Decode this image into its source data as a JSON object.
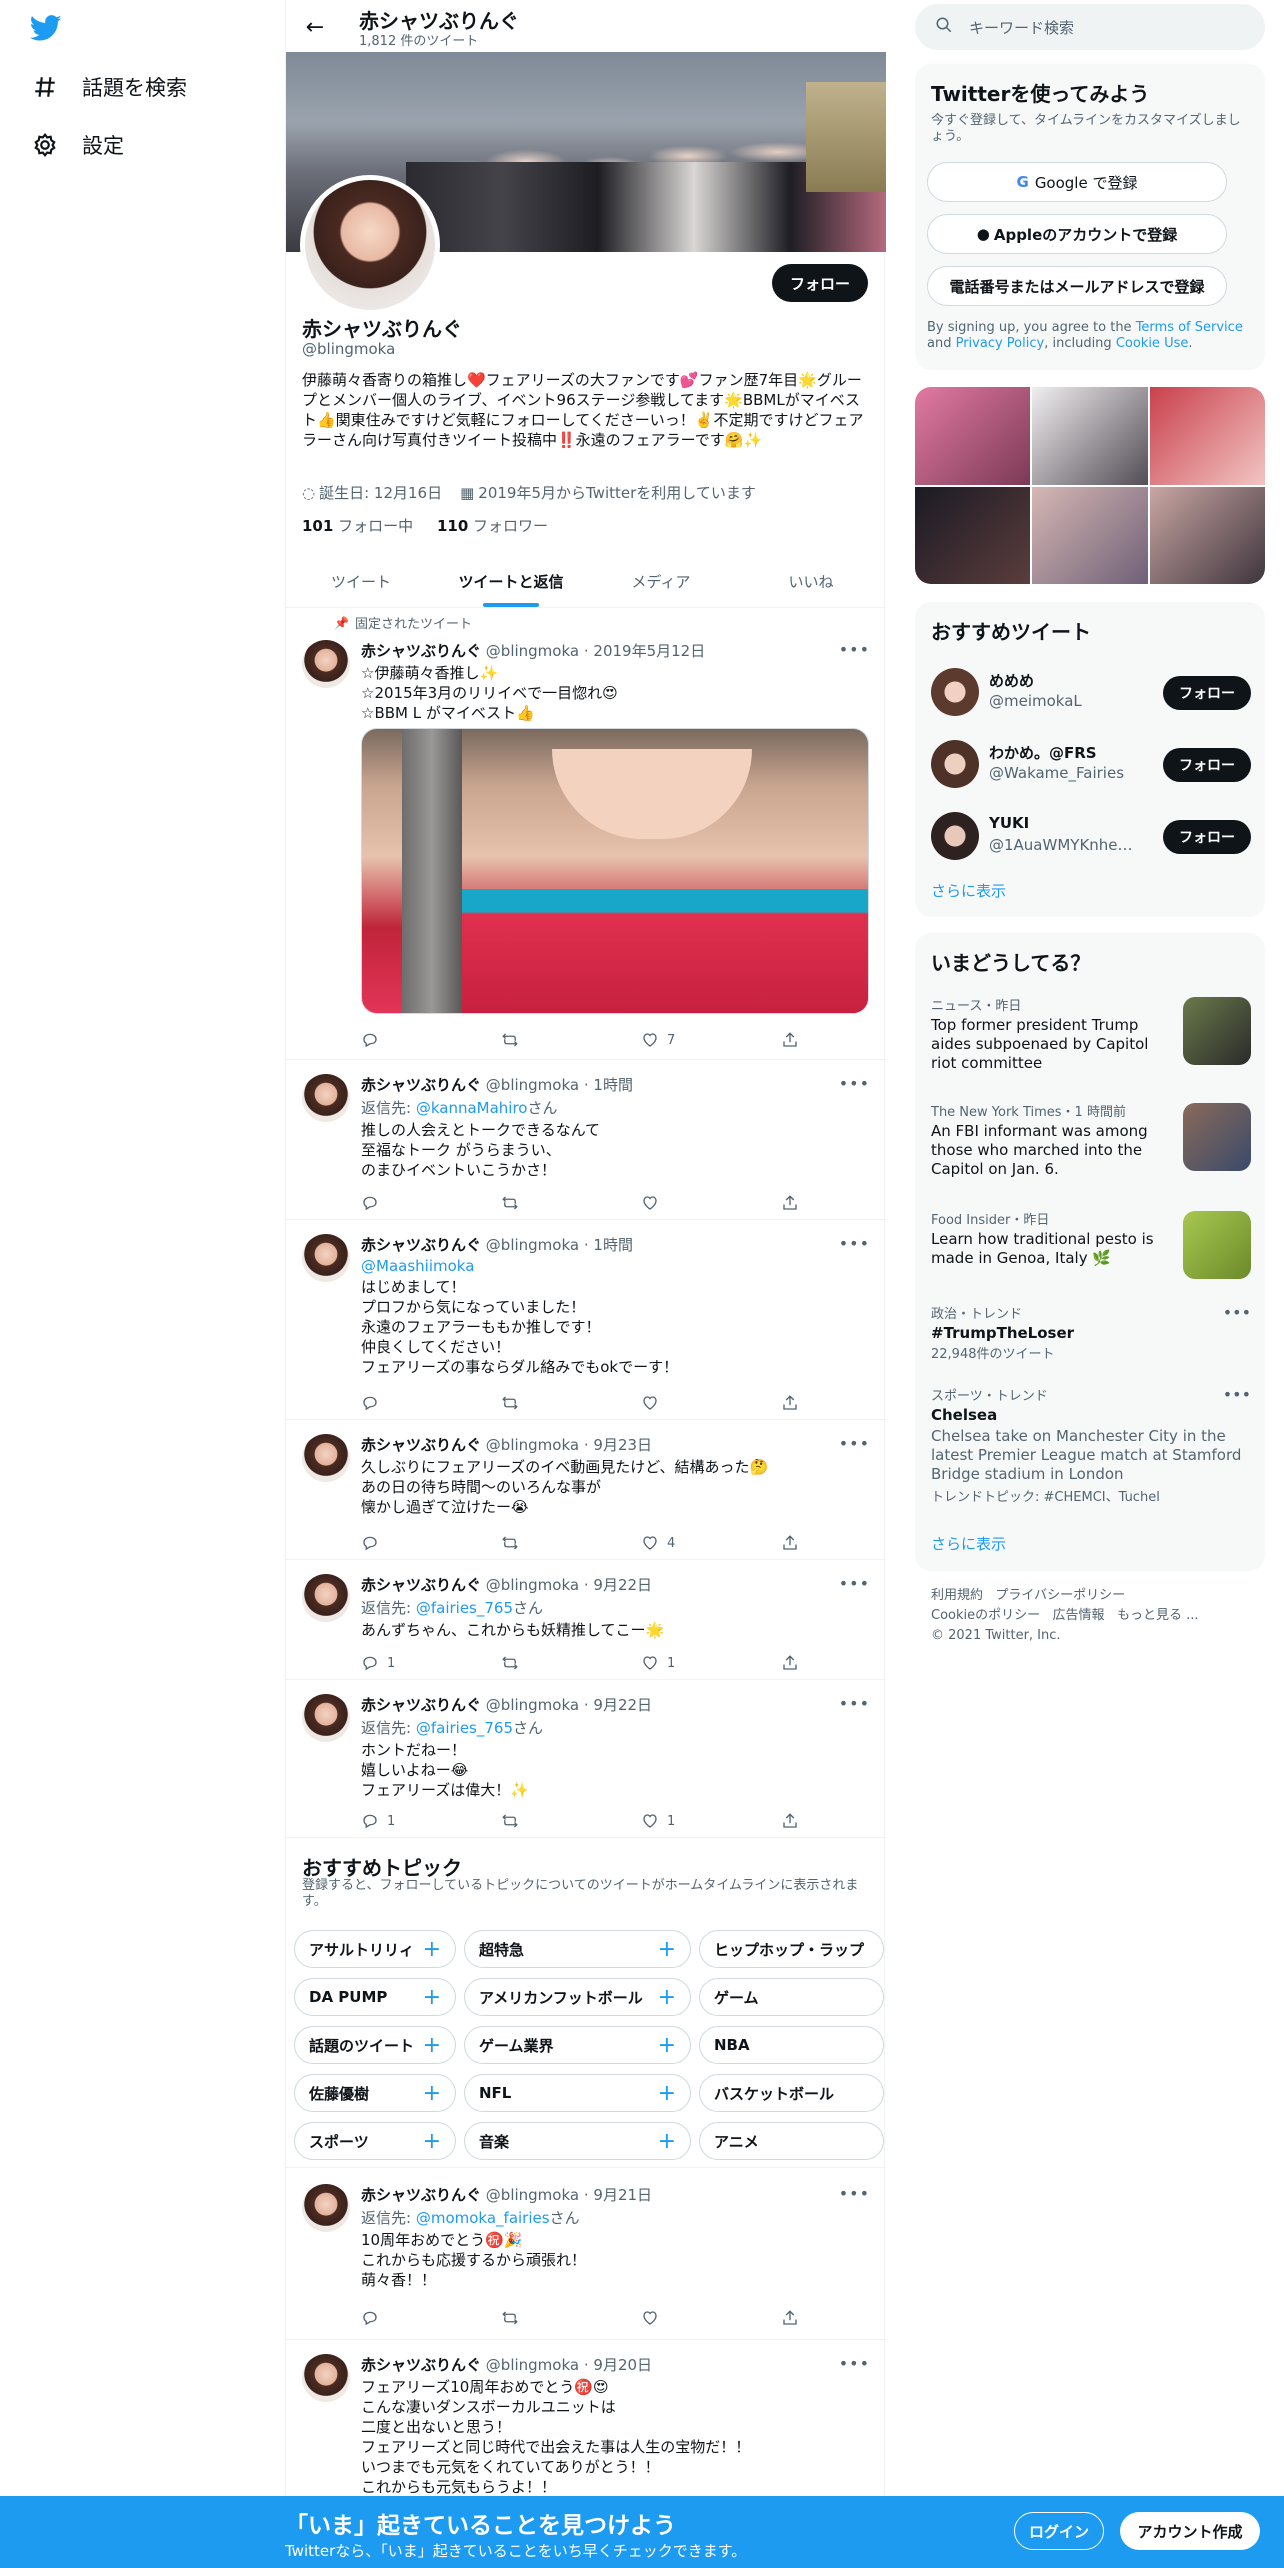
{
  "nav": {
    "explore_label": "話題を検索",
    "settings_label": "設定"
  },
  "header": {
    "name": "赤シャツぶりんぐ",
    "tweet_count": "1,812 件のツイート"
  },
  "profile": {
    "follow_label": "フォロー",
    "name": "赤シャツぶりんぐ",
    "handle": "@blingmoka",
    "bio": "伊藤萌々香寄りの箱推し❤️フェアリーズの大ファンです💕ファン歴7年目🌟グループとメンバー個人のライブ、イベント96ステージ参戦してます🌟BBMLがマイベスト👍関東住みですけど気軽にフォローしてくださーいっ！✌️不定期ですけどフェアラーさん向け写真付きツイート投稿中‼️永遠のフェアラーです🤗✨",
    "birthday": "誕生日: 12月16日",
    "joined": "2019年5月からTwitterを利用しています",
    "following_count": "101",
    "following_label": "フォロー中",
    "followers_count": "110",
    "followers_label": "フォロワー"
  },
  "tabs": [
    "ツイート",
    "ツイートと返信",
    "メディア",
    "いいね"
  ],
  "pinned_label": "固定されたツイート",
  "tweets": [
    {
      "name": "赤シャツぶりんぐ",
      "handle": "@blingmoka",
      "time": "2019年5月12日",
      "reply_to": "",
      "text": "☆伊藤萌々香推し✨\n☆2015年3月のリリイベで一目惚れ😍\n☆BBM L がマイベスト👍",
      "reply": "",
      "retweet": "",
      "like": "7"
    },
    {
      "name": "赤シャツぶりんぐ",
      "handle": "@blingmoka",
      "time": "1時間",
      "reply_to": "@kannaMahiro",
      "text": "推しの人会えとトークできるなんて\n至福なトーク がうらまうい、\nのまひイベントいこうかさ！",
      "reply": "",
      "retweet": "",
      "like": ""
    },
    {
      "name": "赤シャツぶりんぐ",
      "handle": "@blingmoka",
      "time": "1時間",
      "reply_to": "",
      "mention": "@Maashiimoka",
      "text": "はじめまして！\nプロフから気になっていました！\n永遠のフェアラーももか推しです！\n仲良くしてください！\nフェアリーズの事ならダル絡みでもokでーす！",
      "reply": "",
      "retweet": "",
      "like": ""
    },
    {
      "name": "赤シャツぶりんぐ",
      "handle": "@blingmoka",
      "time": "9月23日",
      "reply_to": "",
      "text": "久しぶりにフェアリーズのイベ動画見たけど、結構あった🤔\nあの日の待ち時間〜のいろんな事が\n懐かし過ぎて泣けたー😭",
      "reply": "",
      "retweet": "",
      "like": "4"
    },
    {
      "name": "赤シャツぶりんぐ",
      "handle": "@blingmoka",
      "time": "9月22日",
      "reply_to": "@fairies_765",
      "text": "あんずちゃん、これからも妖精推してこー🌟",
      "reply": "1",
      "retweet": "",
      "like": "1"
    },
    {
      "name": "赤シャツぶりんぐ",
      "handle": "@blingmoka",
      "time": "9月22日",
      "reply_to": "@fairies_765",
      "text": "ホントだねー！\n嬉しいよねー😂\nフェアリーズは偉大！✨",
      "reply": "1",
      "retweet": "",
      "like": "1"
    },
    {
      "name": "赤シャツぶりんぐ",
      "handle": "@blingmoka",
      "time": "9月21日",
      "reply_to": "@momoka_fairies",
      "text": "10周年おめでとう㊗️🎉\nこれからも応援するから頑張れ！\n萌々香！！",
      "reply": "",
      "retweet": "",
      "like": ""
    },
    {
      "name": "赤シャツぶりんぐ",
      "handle": "@blingmoka",
      "time": "9月20日",
      "reply_to": "",
      "text": "フェアリーズ10周年おめでとう㊗️😍\nこんな凄いダンスボーカルユニットは\n二度と出ないと思う！\nフェアリーズと同じ時代で出会えた事は人生の宝物だ！！\nいつまでも元気をくれていてありがとう！！\nこれからも元気もらうよ！！",
      "reply": "",
      "retweet": "",
      "like": ""
    }
  ],
  "reply_prefix": "返信先:",
  "reply_suffix": "さん",
  "topics": {
    "title": "おすすめトピック",
    "desc": "登録すると、フォローしているトピックについてのツイートがホームタイムラインに表示されます。",
    "chips": [
      "アサルトリリィ",
      "超特急",
      "ヒップホップ・ラップ",
      "DA PUMP",
      "アメリカンフットボール",
      "ゲーム",
      "話題のツイート",
      "ゲーム業界",
      "NBA",
      "佐藤優樹",
      "NFL",
      "バスケットボール",
      "スポーツ",
      "音楽",
      "アニメ"
    ]
  },
  "right": {
    "search_placeholder": "キーワード検索",
    "signup": {
      "title": "Twitterを使ってみよう",
      "sub": "今すぐ登録して、タイムラインをカスタマイズしましょう。",
      "google": "Google で登録",
      "apple": "Appleのアカウントで登録",
      "phone": "電話番号またはメールアドレスで登録",
      "terms_pre": "By signing up, you agree to the ",
      "terms": "Terms of Service",
      "and": " and ",
      "privacy": "Privacy Policy",
      "incl": ", including ",
      "cookie": "Cookie Use",
      "end": "."
    },
    "rec_title": "おすすめツイート",
    "recs": [
      {
        "name": "めめめ",
        "handle": "@meimokaL",
        "btn": "フォロー"
      },
      {
        "name": "わかめ。@FRS",
        "handle": "@Wakame_Fairies",
        "btn": "フォロー"
      },
      {
        "name": "YUKI",
        "handle": "@1AuaWMYKnhekB...",
        "btn": "フォロー"
      }
    ],
    "more": "さらに表示",
    "trends_title": "いまどうしてる？",
    "trends": [
      {
        "ctx": "ニュース・昨日",
        "title": "Top former president Trump aides subpoenaed by Capitol riot committee"
      },
      {
        "ctx": "The New York Times・1 時間前",
        "title": "An FBI informant was among those who marched into the Capitol on Jan. 6."
      },
      {
        "ctx": "Food Insider・昨日",
        "title": "Learn how traditional pesto is made in Genoa, Italy 🌿"
      },
      {
        "ctx": "政治・トレンド",
        "title": "#TrumpTheLoser",
        "sub": "22,948件のツイート"
      },
      {
        "ctx": "スポーツ・トレンド",
        "title": "Chelsea",
        "sub": "Chelsea take on Manchester City in the latest Premier League match at Stamford Bridge stadium in London",
        "topic": "トレンドトピック: #CHEMCI、Tuchel"
      }
    ],
    "trends_more": "さらに表示",
    "footer": [
      "利用規約",
      "プライバシーポリシー",
      "Cookieのポリシー",
      "広告情報",
      "もっと見る ...",
      "© 2021 Twitter, Inc."
    ]
  },
  "bottom": {
    "title": "「いま」起きていることを見つけよう",
    "sub": "Twitterなら、「いま」起きていることをいち早くチェックできます。",
    "login": "ログイン",
    "signup": "アカウント作成"
  },
  "colors": {
    "accent": "#1d9bf0",
    "text": "#0f1419",
    "muted": "#536471"
  }
}
